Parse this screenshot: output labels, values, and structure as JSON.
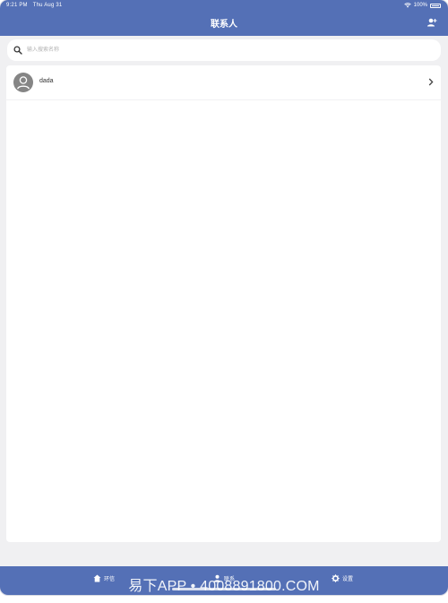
{
  "status_bar": {
    "time": "9:21 PM",
    "date": "Thu Aug 31",
    "battery": "100%"
  },
  "header": {
    "title": "联系人",
    "add_icon": "add-contact-icon"
  },
  "search": {
    "placeholder": "输入搜索名称",
    "icon": "search-icon"
  },
  "contacts": [
    {
      "name": "dada",
      "avatar_icon": "person-icon",
      "chevron_icon": "chevron-right-icon"
    }
  ],
  "tabs": [
    {
      "label": "环信",
      "icon": "home-icon"
    },
    {
      "label": "联系",
      "icon": "contacts-icon"
    },
    {
      "label": "设置",
      "icon": "gear-icon"
    }
  ],
  "watermark": "易下APP • 4008891800.COM",
  "colors": {
    "accent": "#5470b6",
    "background": "#f0f0f2",
    "panel": "#ffffff"
  }
}
